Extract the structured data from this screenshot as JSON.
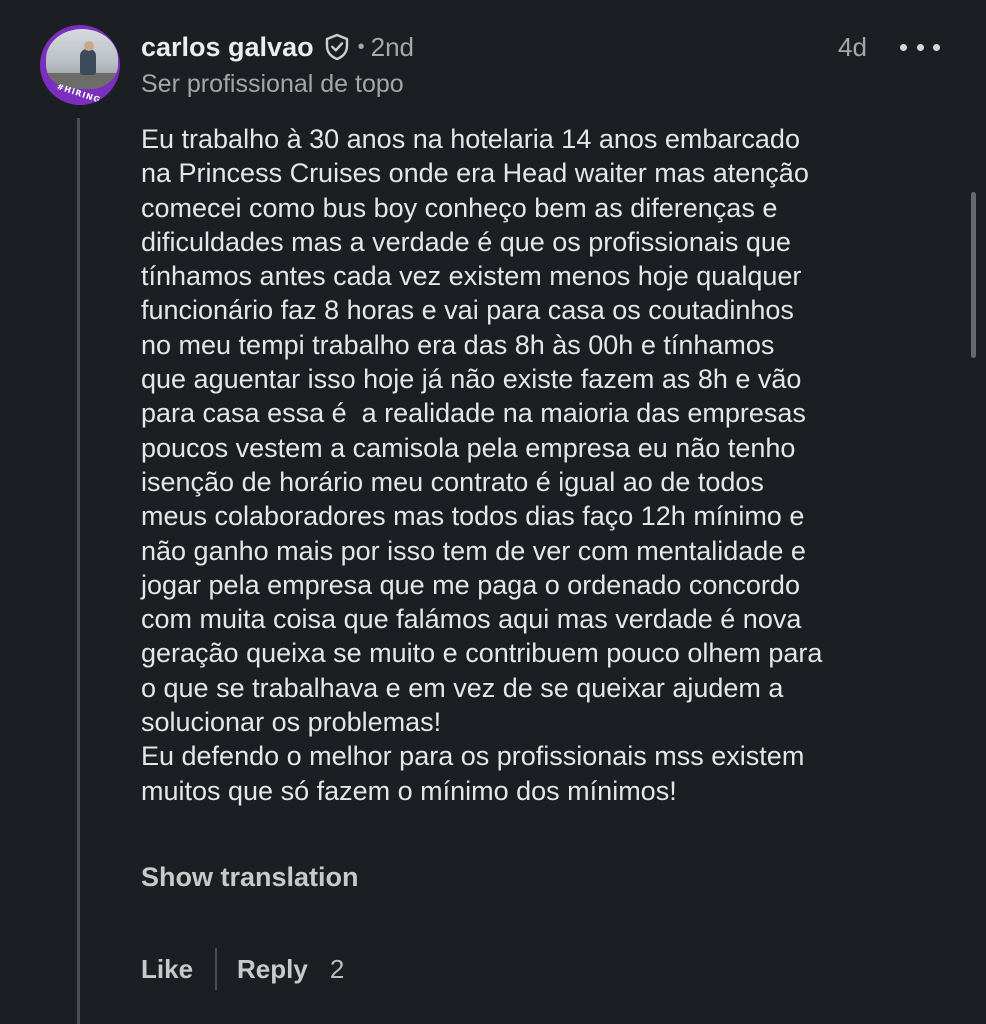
{
  "comment": {
    "author": {
      "name": "carlos galvao",
      "degree": "2nd",
      "headline": "Ser profissional de topo",
      "avatar_badge": "#HIRING",
      "verified_icon": "shield-check-icon"
    },
    "separator": "•",
    "time": "4d",
    "more_icon": "more-horizontal-icon",
    "body_lines": [
      "Eu trabalho à 30 anos na hotelaria 14 anos embarcado",
      "na Princess Cruises onde era Head waiter mas atenção",
      "comecei como bus boy conheço bem as diferenças e",
      "dificuldades mas a verdade é que os profissionais que",
      "tínhamos antes cada vez existem menos hoje qualquer",
      "funcionário faz 8 horas e vai para casa os coutadinhos",
      "no meu tempi trabalho era das 8h às 00h e tínhamos",
      "que aguentar isso hoje já não existe fazem as 8h e vão",
      "para casa essa é  a realidade na maioria das empresas",
      "poucos vestem a camisola pela empresa eu não tenho",
      "isenção de horário meu contrato é igual ao de todos",
      "meus colaboradores mas todos dias faço 12h mínimo e",
      "não ganho mais por isso tem de ver com mentalidade e",
      "jogar pela empresa que me paga o ordenado concordo",
      "com muita coisa que falámos aqui mas verdade é nova",
      "geração queixa se muito e contribuem pouco olhem para",
      "o que se trabalhava e em vez de se queixar ajudem a",
      "solucionar os problemas!",
      "Eu defendo o melhor para os profissionais mss existem",
      "muitos que só fazem o mínimo dos mínimos!"
    ],
    "show_translation_label": "Show translation",
    "actions": {
      "like_label": "Like",
      "reply_label": "Reply",
      "reply_count": "2"
    }
  },
  "colors": {
    "background": "#1b1f23",
    "text_primary": "#e6e6e6",
    "text_secondary": "#a6a6a6",
    "hiring_ring": "#7b2fbe"
  }
}
